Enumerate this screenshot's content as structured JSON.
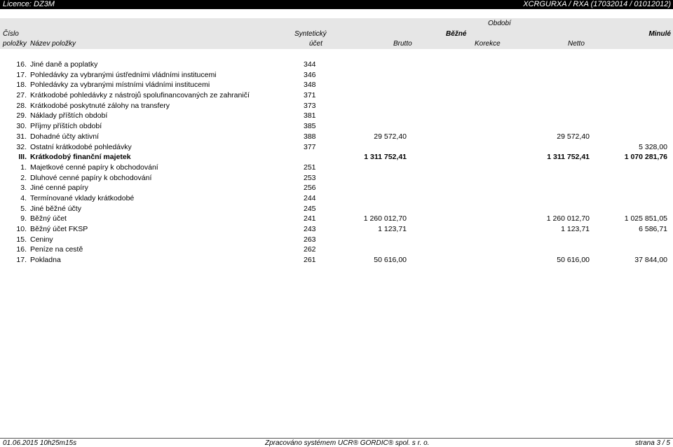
{
  "topbar": {
    "left": "Licence: DZ3M",
    "right": "XCRGURXA / RXA  (17032014 / 01012012)"
  },
  "header": {
    "obdobi": "Období",
    "cislo": "Číslo",
    "polozky": "položky",
    "nazev": "Název položky",
    "synteticky": "Syntetický",
    "ucet": "účet",
    "bezne": "Běžné",
    "minule": "Minulé",
    "brutto": "Brutto",
    "korekce": "Korekce",
    "netto": "Netto"
  },
  "rows": [
    {
      "num": "16.",
      "name": "Jiné daně a poplatky",
      "syn": "344",
      "brutto": "",
      "netto": "",
      "minule": "",
      "bold": false
    },
    {
      "num": "17.",
      "name": "Pohledávky za vybranými ústředními vládními institucemi",
      "syn": "346",
      "brutto": "",
      "netto": "",
      "minule": "",
      "bold": false
    },
    {
      "num": "18.",
      "name": "Pohledávky za vybranými místními vládními institucemi",
      "syn": "348",
      "brutto": "",
      "netto": "",
      "minule": "",
      "bold": false
    },
    {
      "num": "27.",
      "name": "Krátkodobé pohledávky z nástrojů spolufinancovaných ze zahraničí",
      "syn": "371",
      "brutto": "",
      "netto": "",
      "minule": "",
      "bold": false
    },
    {
      "num": "28.",
      "name": "Krátkodobé poskytnuté zálohy na transfery",
      "syn": "373",
      "brutto": "",
      "netto": "",
      "minule": "",
      "bold": false
    },
    {
      "num": "29.",
      "name": "Náklady příštích období",
      "syn": "381",
      "brutto": "",
      "netto": "",
      "minule": "",
      "bold": false
    },
    {
      "num": "30.",
      "name": "Příjmy příštích období",
      "syn": "385",
      "brutto": "",
      "netto": "",
      "minule": "",
      "bold": false
    },
    {
      "num": "31.",
      "name": "Dohadné účty aktivní",
      "syn": "388",
      "brutto": "29 572,40",
      "netto": "29 572,40",
      "minule": "",
      "bold": false
    },
    {
      "num": "32.",
      "name": "Ostatní krátkodobé pohledávky",
      "syn": "377",
      "brutto": "",
      "netto": "",
      "minule": "5 328,00",
      "bold": false
    },
    {
      "num": "III.",
      "name": "Krátkodobý finanční majetek",
      "syn": "",
      "brutto": "1 311 752,41",
      "netto": "1 311 752,41",
      "minule": "1 070 281,76",
      "bold": true
    },
    {
      "num": "1.",
      "name": "Majetkové cenné papíry k obchodování",
      "syn": "251",
      "brutto": "",
      "netto": "",
      "minule": "",
      "bold": false
    },
    {
      "num": "2.",
      "name": "Dluhové cenné papíry k obchodování",
      "syn": "253",
      "brutto": "",
      "netto": "",
      "minule": "",
      "bold": false
    },
    {
      "num": "3.",
      "name": "Jiné cenné papíry",
      "syn": "256",
      "brutto": "",
      "netto": "",
      "minule": "",
      "bold": false
    },
    {
      "num": "4.",
      "name": "Termínované vklady krátkodobé",
      "syn": "244",
      "brutto": "",
      "netto": "",
      "minule": "",
      "bold": false
    },
    {
      "num": "5.",
      "name": "Jiné běžné účty",
      "syn": "245",
      "brutto": "",
      "netto": "",
      "minule": "",
      "bold": false
    },
    {
      "num": "9.",
      "name": "Běžný účet",
      "syn": "241",
      "brutto": "1 260 012,70",
      "netto": "1 260 012,70",
      "minule": "1 025 851,05",
      "bold": false
    },
    {
      "num": "10.",
      "name": "Běžný účet FKSP",
      "syn": "243",
      "brutto": "1 123,71",
      "netto": "1 123,71",
      "minule": "6 586,71",
      "bold": false
    },
    {
      "num": "15.",
      "name": "Ceniny",
      "syn": "263",
      "brutto": "",
      "netto": "",
      "minule": "",
      "bold": false
    },
    {
      "num": "16.",
      "name": "Peníze na cestě",
      "syn": "262",
      "brutto": "",
      "netto": "",
      "minule": "",
      "bold": false
    },
    {
      "num": "17.",
      "name": "Pokladna",
      "syn": "261",
      "brutto": "50 616,00",
      "netto": "50 616,00",
      "minule": "37 844,00",
      "bold": false
    }
  ],
  "footer": {
    "left": "01.06.2015 10h25m15s",
    "center": "Zpracováno systémem UCR® GORDIC® spol. s  r. o.",
    "right": "strana 3 / 5"
  }
}
